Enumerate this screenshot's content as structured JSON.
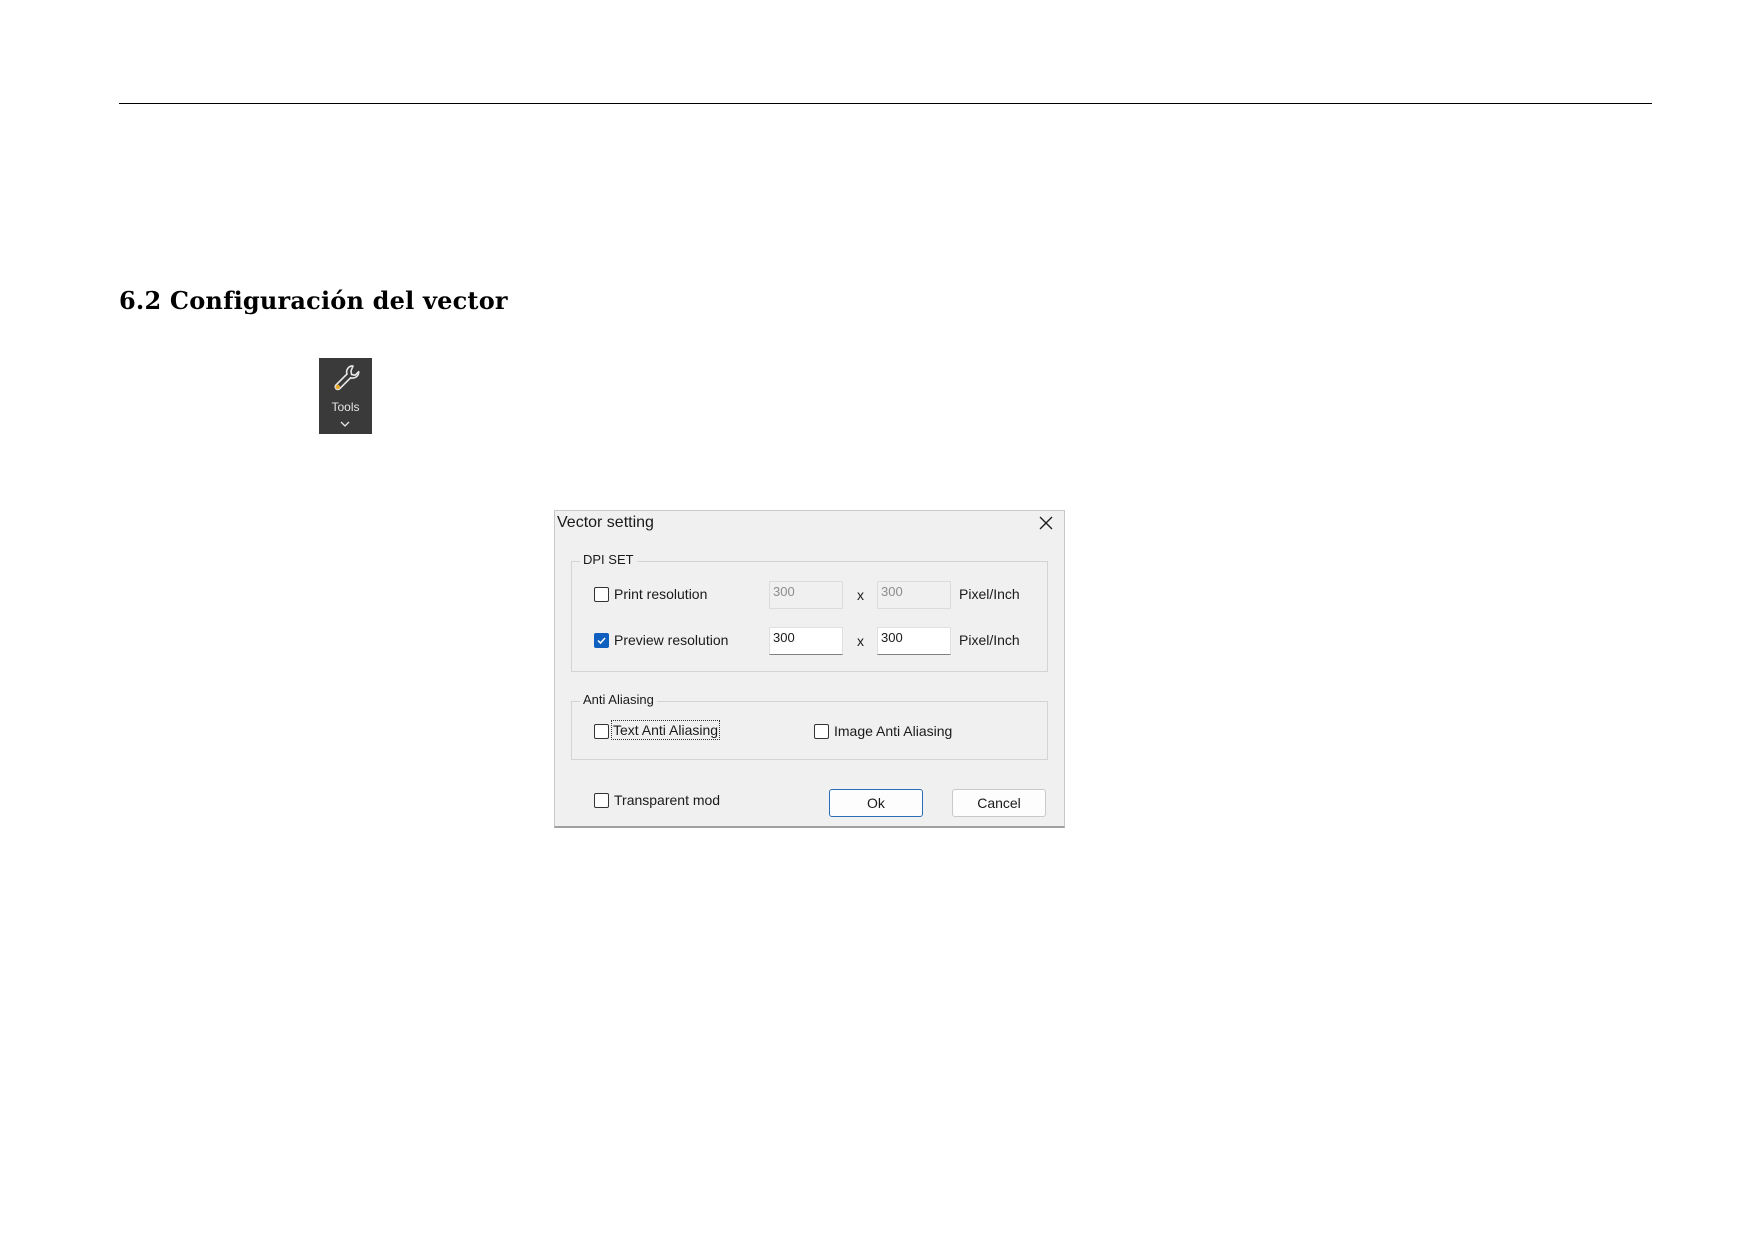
{
  "document": {
    "heading": "6.2 Configuración del vector"
  },
  "toolbar": {
    "tools_label": "Tools",
    "tools_icon": "wrench-icon",
    "dropdown_icon": "chevron-down-icon"
  },
  "dialog": {
    "title": "Vector setting",
    "close_icon": "close-icon",
    "dpi_group": {
      "legend": "DPI SET",
      "print": {
        "label": "Print resolution",
        "checked": false,
        "x": "300",
        "y": "300",
        "separator": "x",
        "unit": "Pixel/Inch",
        "enabled": false
      },
      "preview": {
        "label": "Preview resolution",
        "checked": true,
        "x": "300",
        "y": "300",
        "separator": "x",
        "unit": "Pixel/Inch",
        "enabled": true
      }
    },
    "aa_group": {
      "legend": "Anti Aliasing",
      "text_aa": {
        "label": "Text Anti Aliasing",
        "checked": false
      },
      "image_aa": {
        "label": "Image Anti Aliasing",
        "checked": false
      }
    },
    "transparent": {
      "label": "Transparent mod",
      "checked": false
    },
    "ok_label": "Ok",
    "cancel_label": "Cancel",
    "accent_color": "#0f5fbf"
  }
}
